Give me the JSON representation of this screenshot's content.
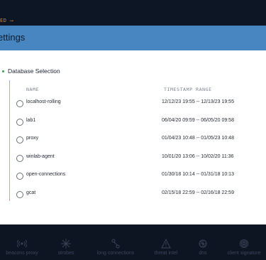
{
  "topbar": {
    "status_text": "ED  ⟶"
  },
  "header": {
    "title": "ettings"
  },
  "database_selection": {
    "title": "Database Selection",
    "columns": {
      "name": "NAME",
      "range": "TIMESTAMP RANGE"
    },
    "rows": [
      {
        "name": "localhost-rolling",
        "range": "12/12/23 19:55 -- 12/13/23 19:55"
      },
      {
        "name": "lab1",
        "range": "06/04/20 09:59 -- 06/05/20 09:58"
      },
      {
        "name": "proxy",
        "range": "01/04/23 10:48 -- 01/05/23 10:48"
      },
      {
        "name": "winlab-agent",
        "range": "10/01/20 13:06 -- 10/02/20 11:36"
      },
      {
        "name": "open-connections",
        "range": "01/30/18 10:14 -- 01/31/18 10:13"
      },
      {
        "name": "gcat",
        "range": "02/15/18 22:59 -- 02/16/18 22:59"
      }
    ]
  },
  "footer_nav": [
    {
      "label": "beacons proxy",
      "icon": "broadcast-icon"
    },
    {
      "label": "strobes",
      "icon": "strobe-icon"
    },
    {
      "label": "long connections",
      "icon": "connections-icon"
    },
    {
      "label": "threat intel",
      "icon": "warning-icon"
    },
    {
      "label": "dns",
      "icon": "dns-icon"
    },
    {
      "label": "client signature",
      "icon": "fingerprint-icon"
    }
  ],
  "colors": {
    "header_bg": "#4886c1",
    "accent_orange": "#e07b2c",
    "selection_line": "#e0b12a",
    "dot_green": "#3f9f57",
    "footer_bg": "#0e1522"
  }
}
